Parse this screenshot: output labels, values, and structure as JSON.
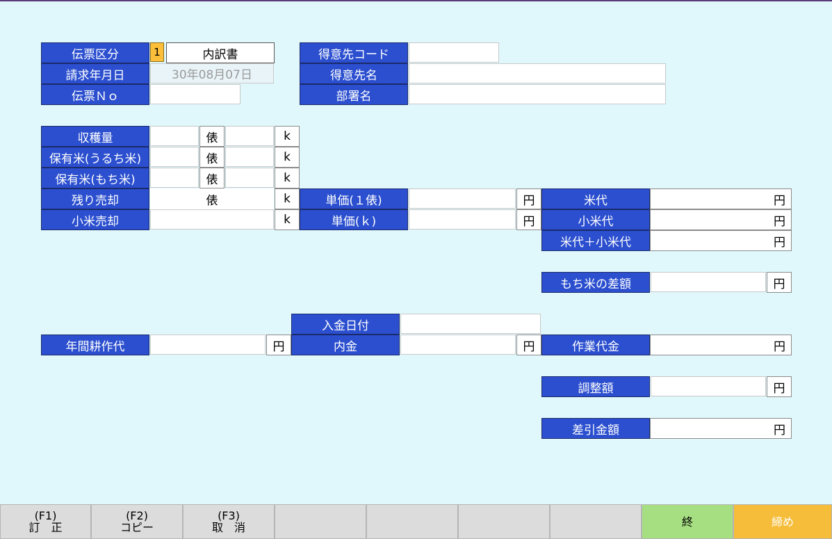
{
  "header": {
    "slip_type_label": "伝票区分",
    "slip_type_code": "1",
    "slip_type_value": "内訳書",
    "billing_date_label": "請求年月日",
    "billing_date_value": "30年08月07日",
    "slip_no_label": "伝票Ｎｏ",
    "slip_no_value": "",
    "customer_code_label": "得意先コード",
    "customer_code_value": "",
    "customer_name_label": "得意先名",
    "customer_name_value": "",
    "department_label": "部署名",
    "department_value": ""
  },
  "harvest": {
    "harvest_label": "収穫量",
    "uruchi_label": "保有米(うるち米)",
    "mochi_label": "保有米(もち米)",
    "remaining_label": "残り売却",
    "small_rice_label": "小米売却",
    "unit_bag": "俵",
    "unit_k": "k"
  },
  "prices": {
    "unit_price_bag_label": "単価(１俵)",
    "unit_price_k_label": "単価(ｋ)",
    "unit_yen": "円"
  },
  "totals": {
    "rice_fee_label": "米代",
    "small_rice_fee_label": "小米代",
    "rice_plus_small_label": "米代＋小米代",
    "mochi_diff_label": "もち米の差額",
    "work_fee_label": "作業代金",
    "adjustment_label": "調整額",
    "net_amount_label": "差引金額",
    "unit_yen": "円"
  },
  "payment": {
    "deposit_date_label": "入金日付",
    "deposit_date_value": "",
    "annual_farming_label": "年間耕作代",
    "advance_label": "内金",
    "unit_yen": "円"
  },
  "function_keys": [
    {
      "key": "(F1)",
      "label": "訂　正"
    },
    {
      "key": "(F2)",
      "label": "コピー"
    },
    {
      "key": "(F3)",
      "label": "取　消"
    },
    {
      "key": "",
      "label": ""
    },
    {
      "key": "",
      "label": ""
    },
    {
      "key": "",
      "label": ""
    },
    {
      "key": "",
      "label": ""
    },
    {
      "key": "",
      "label": "終"
    },
    {
      "key": "",
      "label": "締め"
    }
  ],
  "colors": {
    "background": "#e0f8fc",
    "label_blue": "#2b4fcf",
    "code_orange": "#fdbf3a",
    "end_green": "#a6df82",
    "close_orange": "#f6bd3a"
  }
}
